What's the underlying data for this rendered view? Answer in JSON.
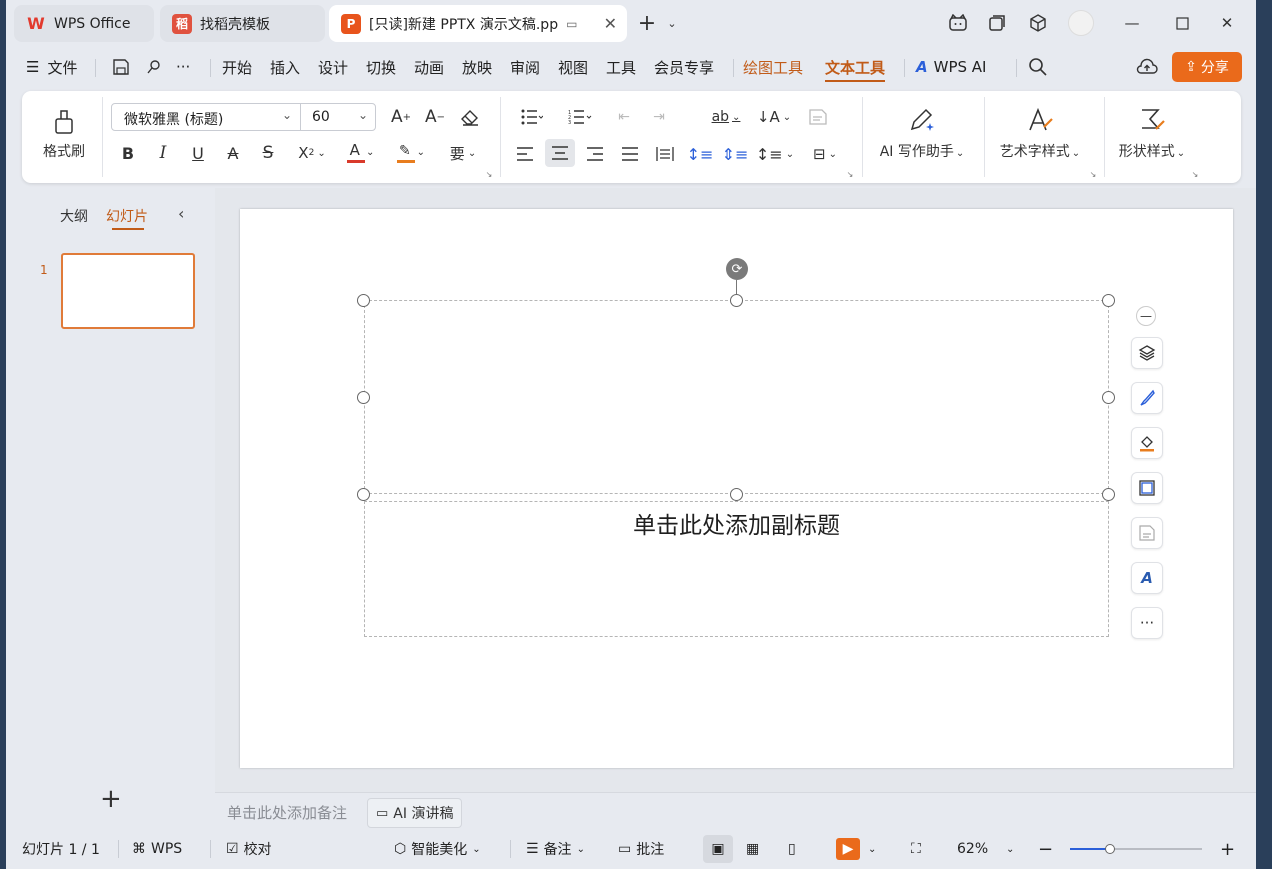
{
  "tabs": [
    {
      "label": "WPS Office",
      "icon": "wps-logo-icon"
    },
    {
      "label": "找稻壳模板",
      "icon": "docer-icon"
    },
    {
      "label": "[只读]新建 PPTX 演示文稿.pp",
      "icon": "ppt-icon"
    }
  ],
  "menu": {
    "file": "文件",
    "items": [
      "开始",
      "插入",
      "设计",
      "切换",
      "动画",
      "放映",
      "审阅",
      "视图",
      "工具",
      "会员专享"
    ],
    "drawing_tools": "绘图工具",
    "text_tools": "文本工具",
    "wps_ai": "WPS AI",
    "share": "分享"
  },
  "ribbon": {
    "format_painter": "格式刷",
    "font_name": "微软雅黑 (标题)",
    "font_size": "60",
    "ai_writer": "AI 写作助手",
    "art_text_style": "艺术字样式",
    "shape_style": "形状样式"
  },
  "panel": {
    "outline_tab": "大纲",
    "slides_tab": "幻灯片",
    "slide_number": "1"
  },
  "slide": {
    "subtitle_placeholder": "单击此处添加副标题"
  },
  "notes": {
    "placeholder": "单击此处添加备注",
    "ai_script": "AI 演讲稿"
  },
  "status": {
    "slide_count": "幻灯片 1 / 1",
    "wps": "WPS",
    "proofread": "校对",
    "smart_beautify": "智能美化",
    "notes": "备注",
    "comments": "批注",
    "zoom": "62%"
  },
  "colors": {
    "accent": "#c15b18",
    "share_button": "#ea6a1b",
    "font_color_underline": "#d93a2b",
    "highlight_underline": "#e87d1e"
  }
}
